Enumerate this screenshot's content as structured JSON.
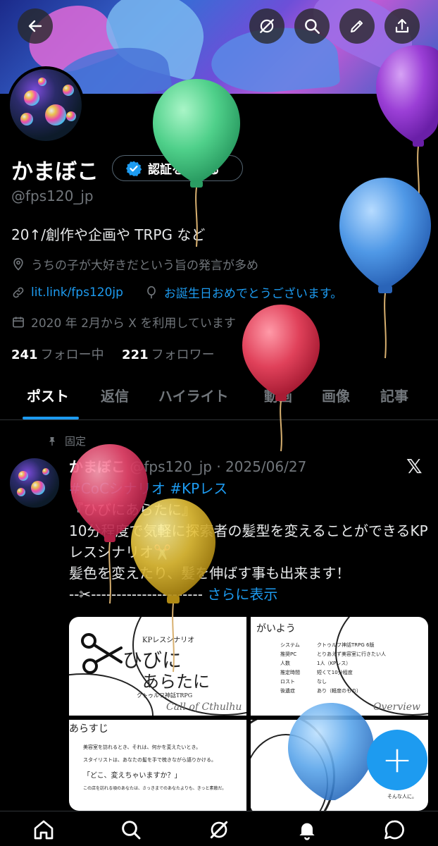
{
  "profile": {
    "name": "かまぼこ",
    "verify_label": "認証を受ける",
    "handle": "@fps120_jp",
    "bio": "20↑/創作や企画や TRPG など",
    "location": "うちの子が大好きだという旨の発言が多め",
    "link": "lit.link/fps120jp",
    "birthday": "お誕生日おめでとうございます。",
    "joined": "2020 年 2月から X を利用しています",
    "following_count": "241",
    "following_label": "フォロー中",
    "followers_count": "221",
    "followers_label": "フォロワー"
  },
  "tabs": [
    "ポスト",
    "返信",
    "ハイライト",
    "動画",
    "画像",
    "記事"
  ],
  "post": {
    "pinned_label": "固定",
    "author": "かまぼこ",
    "handle": "@fps120_jp",
    "date": "· 2025/06/27",
    "hashtags": "#CoCシナリオ #KPレス",
    "line1": "『ひびにあらたに』",
    "line2": "10分程度で気軽に探索者の髪型を変えることができるKPレスシナリオ✂️",
    "line3": "髪色を変えたり、髪を伸ばす事も出来ます！",
    "line4": "--✂︎----------------------",
    "more": "さらに表示"
  },
  "images": {
    "img1_sub": "KPレスシナリオ",
    "img1_title_a": "ひびに",
    "img1_title_b": "あらたに",
    "img1_caption": "クトゥルフ神話TRPG",
    "img1_footer": "Call of Cthulhu",
    "img2_title": "がいよう",
    "img2_rows": [
      [
        "システム",
        "クトゥルフ神話TRPG 6版"
      ],
      [
        "推奨PC",
        "とりあえず美容室に行きたい人"
      ],
      [
        "人数",
        "1人（KPレス）"
      ],
      [
        "推定時間",
        "短くて10分程度"
      ],
      [
        "ロスト",
        "なし"
      ],
      [
        "後遺症",
        "あり（軽度のもの）"
      ]
    ],
    "img2_footer": "Overview",
    "img3_title": "あらすじ",
    "img3_line1": "美容室を訪れるとき、それは、何かを変えたいとき。",
    "img3_line2": "スタイリストは、あなたの髪を手で梳きながら語りかける。",
    "img3_quote": "「どこ、変えちゃいますか？」",
    "img3_line3": "この店を訪れる頃のあなたは、さっきまでのあなたよりも、きっと素敵だ。",
    "img4_label": "そんな人に。"
  },
  "fab_label": "+",
  "nav": [
    "home-icon",
    "search-icon",
    "grok-icon",
    "notifications-icon",
    "messages-icon"
  ],
  "colors": {
    "accent": "#1d9bf0",
    "background": "#000000",
    "muted": "#71767b"
  }
}
